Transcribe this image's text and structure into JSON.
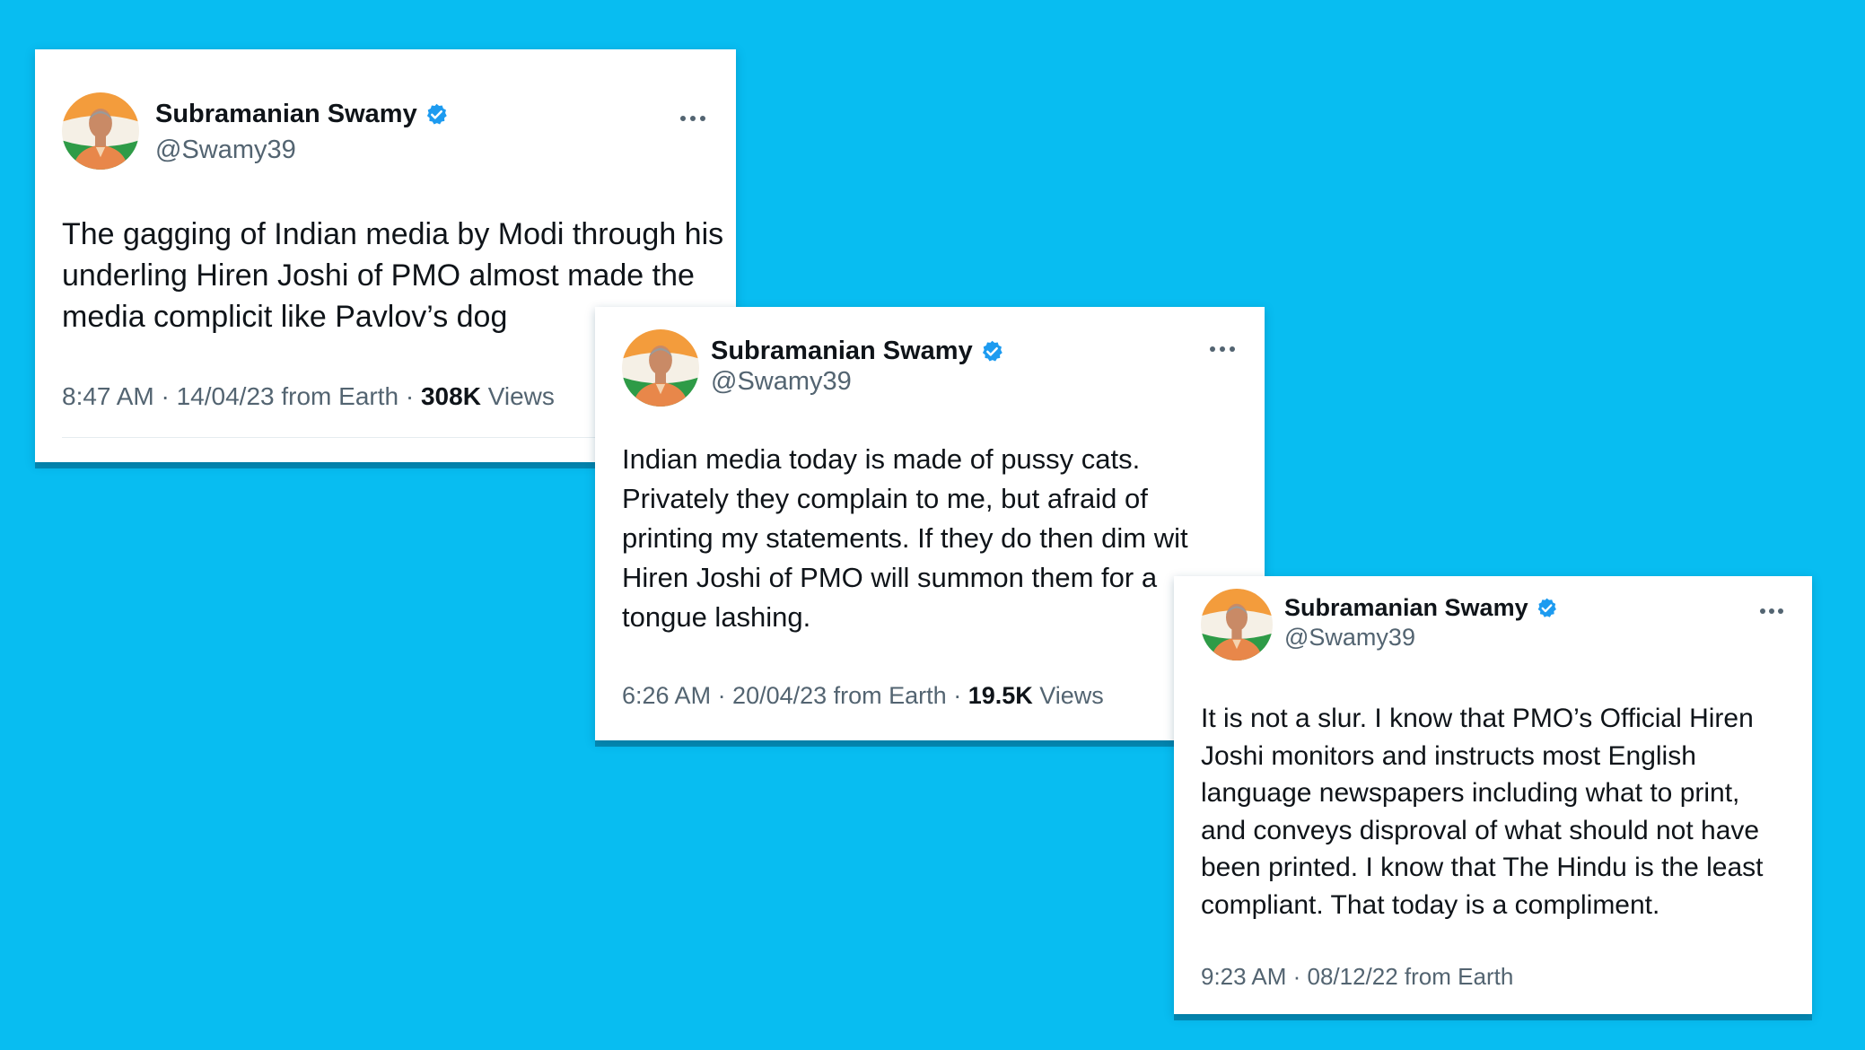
{
  "colors": {
    "background": "#08bdf1",
    "card": "#ffffff",
    "name": "#0f1419",
    "secondary_text": "#536471",
    "verified_badge": "#1d9bf0"
  },
  "tweets": [
    {
      "author_name": "Subramanian Swamy",
      "handle": "@Swamy39",
      "verified": true,
      "more_icon": "more-dots-icon",
      "text_lines": [
        "The gagging of Indian media by Modi through his",
        "underling Hiren Joshi of PMO almost made the",
        "media complicit like Pavlov’s dog"
      ],
      "time_date": "8:47 AM · 14/04/23 from Earth · ",
      "views_count": "308K",
      "views_label": " Views"
    },
    {
      "author_name": "Subramanian Swamy",
      "handle": "@Swamy39",
      "verified": true,
      "more_icon": "more-dots-icon",
      "text_lines": [
        "Indian media today is made of pussy cats.",
        "Privately they complain to me, but afraid of",
        "printing my statements. If they do then dim wit",
        "Hiren Joshi of PMO will summon them for a",
        "tongue lashing."
      ],
      "time_date": "6:26 AM · 20/04/23 from Earth · ",
      "views_count": "19.5K",
      "views_label": " Views"
    },
    {
      "author_name": "Subramanian Swamy",
      "handle": "@Swamy39",
      "verified": true,
      "more_icon": "more-dots-icon",
      "text_lines": [
        "It is not a slur. I know that PMO’s Official Hiren",
        "Joshi monitors and instructs most English",
        "language newspapers including what to print,",
        "and conveys disproval of what should not have",
        "been printed. I know that The Hindu is the least",
        "compliant. That today is a compliment."
      ],
      "time_date": "9:23 AM · 08/12/22 from Earth"
    }
  ]
}
